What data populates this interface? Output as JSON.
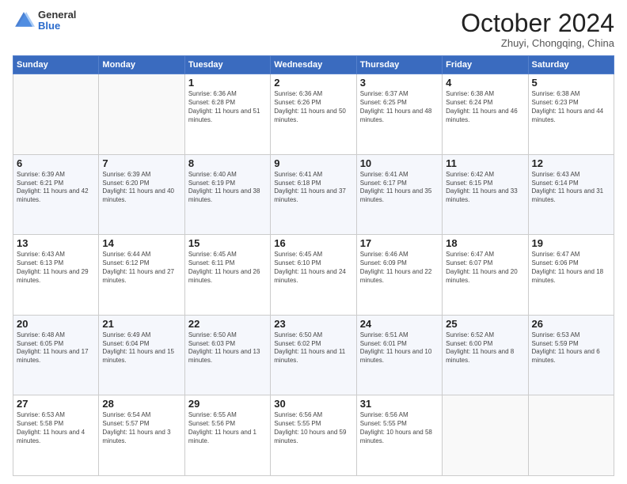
{
  "logo": {
    "general": "General",
    "blue": "Blue"
  },
  "header": {
    "month": "October 2024",
    "location": "Zhuyi, Chongqing, China"
  },
  "weekdays": [
    "Sunday",
    "Monday",
    "Tuesday",
    "Wednesday",
    "Thursday",
    "Friday",
    "Saturday"
  ],
  "weeks": [
    [
      {
        "day": "",
        "text": ""
      },
      {
        "day": "",
        "text": ""
      },
      {
        "day": "1",
        "text": "Sunrise: 6:36 AM\nSunset: 6:28 PM\nDaylight: 11 hours and 51 minutes."
      },
      {
        "day": "2",
        "text": "Sunrise: 6:36 AM\nSunset: 6:26 PM\nDaylight: 11 hours and 50 minutes."
      },
      {
        "day": "3",
        "text": "Sunrise: 6:37 AM\nSunset: 6:25 PM\nDaylight: 11 hours and 48 minutes."
      },
      {
        "day": "4",
        "text": "Sunrise: 6:38 AM\nSunset: 6:24 PM\nDaylight: 11 hours and 46 minutes."
      },
      {
        "day": "5",
        "text": "Sunrise: 6:38 AM\nSunset: 6:23 PM\nDaylight: 11 hours and 44 minutes."
      }
    ],
    [
      {
        "day": "6",
        "text": "Sunrise: 6:39 AM\nSunset: 6:21 PM\nDaylight: 11 hours and 42 minutes."
      },
      {
        "day": "7",
        "text": "Sunrise: 6:39 AM\nSunset: 6:20 PM\nDaylight: 11 hours and 40 minutes."
      },
      {
        "day": "8",
        "text": "Sunrise: 6:40 AM\nSunset: 6:19 PM\nDaylight: 11 hours and 38 minutes."
      },
      {
        "day": "9",
        "text": "Sunrise: 6:41 AM\nSunset: 6:18 PM\nDaylight: 11 hours and 37 minutes."
      },
      {
        "day": "10",
        "text": "Sunrise: 6:41 AM\nSunset: 6:17 PM\nDaylight: 11 hours and 35 minutes."
      },
      {
        "day": "11",
        "text": "Sunrise: 6:42 AM\nSunset: 6:15 PM\nDaylight: 11 hours and 33 minutes."
      },
      {
        "day": "12",
        "text": "Sunrise: 6:43 AM\nSunset: 6:14 PM\nDaylight: 11 hours and 31 minutes."
      }
    ],
    [
      {
        "day": "13",
        "text": "Sunrise: 6:43 AM\nSunset: 6:13 PM\nDaylight: 11 hours and 29 minutes."
      },
      {
        "day": "14",
        "text": "Sunrise: 6:44 AM\nSunset: 6:12 PM\nDaylight: 11 hours and 27 minutes."
      },
      {
        "day": "15",
        "text": "Sunrise: 6:45 AM\nSunset: 6:11 PM\nDaylight: 11 hours and 26 minutes."
      },
      {
        "day": "16",
        "text": "Sunrise: 6:45 AM\nSunset: 6:10 PM\nDaylight: 11 hours and 24 minutes."
      },
      {
        "day": "17",
        "text": "Sunrise: 6:46 AM\nSunset: 6:09 PM\nDaylight: 11 hours and 22 minutes."
      },
      {
        "day": "18",
        "text": "Sunrise: 6:47 AM\nSunset: 6:07 PM\nDaylight: 11 hours and 20 minutes."
      },
      {
        "day": "19",
        "text": "Sunrise: 6:47 AM\nSunset: 6:06 PM\nDaylight: 11 hours and 18 minutes."
      }
    ],
    [
      {
        "day": "20",
        "text": "Sunrise: 6:48 AM\nSunset: 6:05 PM\nDaylight: 11 hours and 17 minutes."
      },
      {
        "day": "21",
        "text": "Sunrise: 6:49 AM\nSunset: 6:04 PM\nDaylight: 11 hours and 15 minutes."
      },
      {
        "day": "22",
        "text": "Sunrise: 6:50 AM\nSunset: 6:03 PM\nDaylight: 11 hours and 13 minutes."
      },
      {
        "day": "23",
        "text": "Sunrise: 6:50 AM\nSunset: 6:02 PM\nDaylight: 11 hours and 11 minutes."
      },
      {
        "day": "24",
        "text": "Sunrise: 6:51 AM\nSunset: 6:01 PM\nDaylight: 11 hours and 10 minutes."
      },
      {
        "day": "25",
        "text": "Sunrise: 6:52 AM\nSunset: 6:00 PM\nDaylight: 11 hours and 8 minutes."
      },
      {
        "day": "26",
        "text": "Sunrise: 6:53 AM\nSunset: 5:59 PM\nDaylight: 11 hours and 6 minutes."
      }
    ],
    [
      {
        "day": "27",
        "text": "Sunrise: 6:53 AM\nSunset: 5:58 PM\nDaylight: 11 hours and 4 minutes."
      },
      {
        "day": "28",
        "text": "Sunrise: 6:54 AM\nSunset: 5:57 PM\nDaylight: 11 hours and 3 minutes."
      },
      {
        "day": "29",
        "text": "Sunrise: 6:55 AM\nSunset: 5:56 PM\nDaylight: 11 hours and 1 minute."
      },
      {
        "day": "30",
        "text": "Sunrise: 6:56 AM\nSunset: 5:55 PM\nDaylight: 10 hours and 59 minutes."
      },
      {
        "day": "31",
        "text": "Sunrise: 6:56 AM\nSunset: 5:55 PM\nDaylight: 10 hours and 58 minutes."
      },
      {
        "day": "",
        "text": ""
      },
      {
        "day": "",
        "text": ""
      }
    ]
  ]
}
